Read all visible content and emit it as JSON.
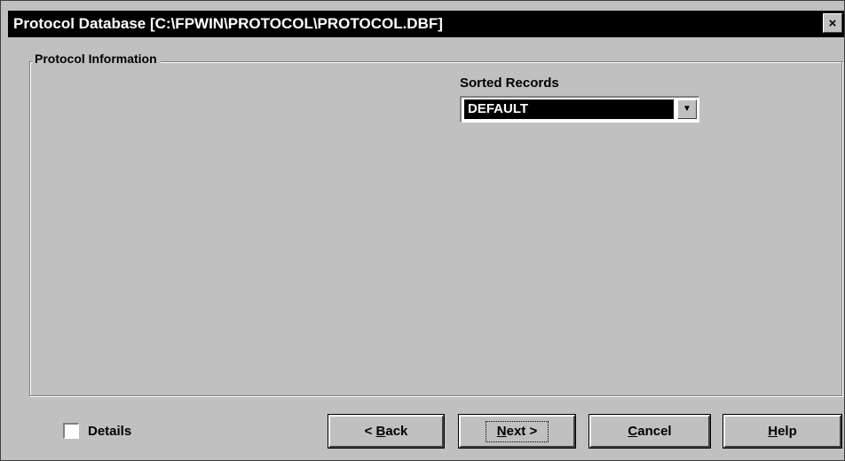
{
  "window": {
    "title": "Protocol Database [C:\\FPWIN\\PROTOCOL\\PROTOCOL.DBF]",
    "close_label": "×"
  },
  "group": {
    "legend": "Protocol Information"
  },
  "sort": {
    "label": "Sorted Records",
    "value": "DEFAULT",
    "arrow_icon": "chevron-down-icon"
  },
  "details": {
    "label": "Details",
    "checked": false
  },
  "buttons": {
    "back_prefix": "< ",
    "back_mnemonic": "B",
    "back_rest": "ack",
    "next_mnemonic": "N",
    "next_rest": "ext >",
    "cancel_mnemonic": "C",
    "cancel_rest": "ancel",
    "help_mnemonic": "H",
    "help_rest": "elp"
  },
  "colors": {
    "face": "#c0c0c0",
    "titlebar": "#000000",
    "selection": "#000000"
  }
}
